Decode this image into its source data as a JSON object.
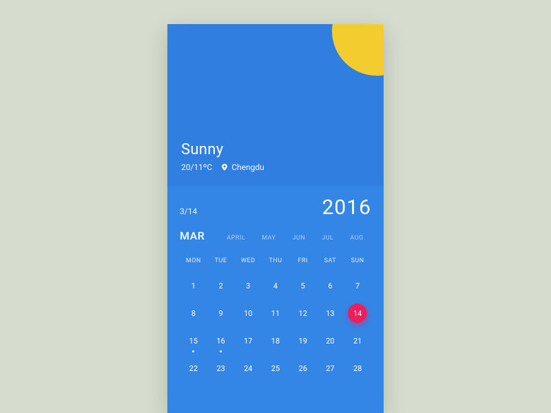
{
  "weather": {
    "condition": "Sunny",
    "temps": "20/11ºC",
    "location": "Chengdu"
  },
  "calendar": {
    "short_date": "3/14",
    "year": "2016",
    "months": [
      "MAR",
      "APRIL",
      "MAY",
      "JUN",
      "JUL",
      "AUG"
    ],
    "current_month_index": 0,
    "days_of_week": [
      "MON",
      "TUE",
      "WED",
      "THU",
      "FRI",
      "SAT",
      "SUN"
    ],
    "days": [
      1,
      2,
      3,
      4,
      5,
      6,
      7,
      8,
      9,
      10,
      11,
      12,
      13,
      14,
      15,
      16,
      17,
      18,
      19,
      20,
      21,
      22,
      23,
      24,
      25,
      26,
      27,
      28
    ],
    "selected_day": 14,
    "event_days": [
      15,
      16
    ]
  },
  "colors": {
    "bg": "#d6ddce",
    "panel_top": "#2f7ee0",
    "panel_bottom": "#3386e6",
    "sun": "#f3cc30",
    "accent": "#ec1e5b"
  }
}
